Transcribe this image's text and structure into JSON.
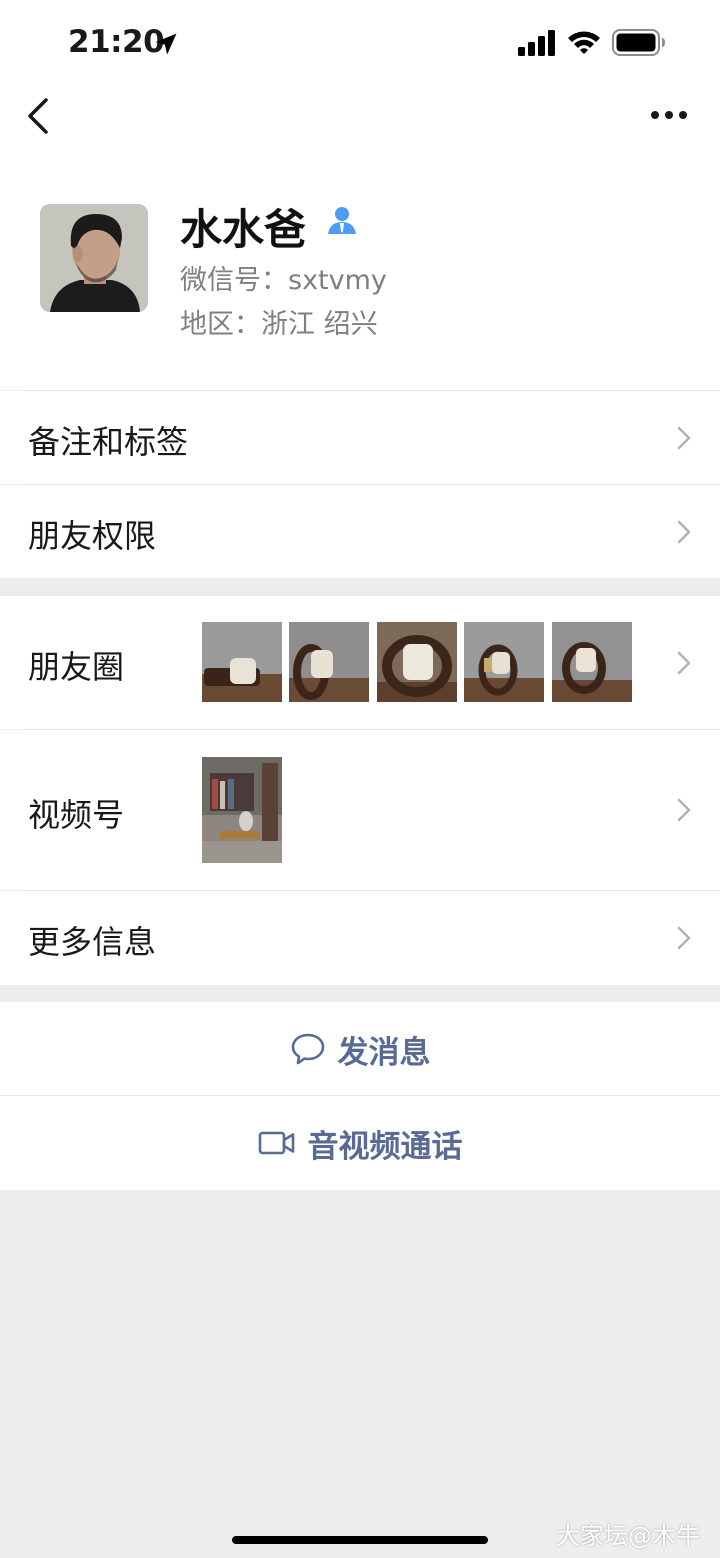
{
  "status_bar": {
    "time": "21:20"
  },
  "profile": {
    "name": "水水爸",
    "wechat_id": "微信号：sxtvmy",
    "region": "地区：浙江 绍兴"
  },
  "rows": {
    "remark": "备注和标签",
    "permissions": "朋友权限",
    "moments": "朋友圈",
    "channels": "视频号",
    "more_info": "更多信息"
  },
  "actions": {
    "message": "发消息",
    "call": "音视频通话"
  },
  "watermark": "大家坛@木牛",
  "colors": {
    "link": "#576b95",
    "background": "#ededed",
    "verify": "#4f9df2"
  },
  "icons": [
    "location-arrow-icon",
    "signal-icon",
    "wifi-icon",
    "battery-icon",
    "back-icon",
    "more-icon",
    "verified-person-icon",
    "chevron-right-icon",
    "chat-bubble-icon",
    "video-camera-icon"
  ]
}
